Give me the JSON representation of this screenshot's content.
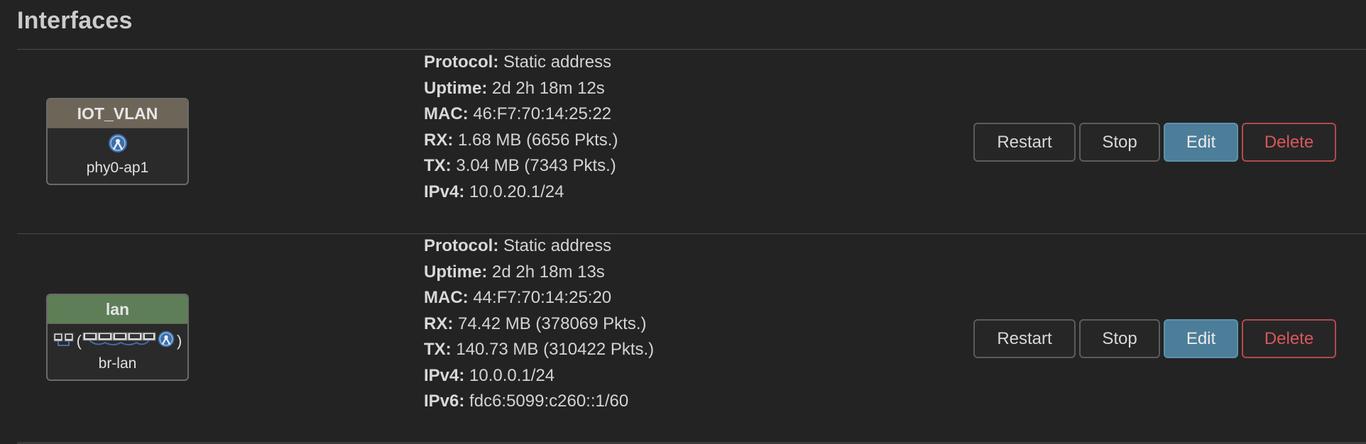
{
  "page": {
    "title": "Interfaces"
  },
  "labels": {
    "protocol": "Protocol:",
    "uptime": "Uptime:",
    "mac": "MAC:",
    "rx": "RX:",
    "tx": "TX:",
    "ipv4": "IPv4:",
    "ipv6": "IPv6:"
  },
  "buttons": {
    "restart": "Restart",
    "stop": "Stop",
    "edit": "Edit",
    "delete": "Delete"
  },
  "interfaces": [
    {
      "name": "IOT_VLAN",
      "device": "phy0-ap1",
      "header_color": "#6e6559",
      "icons": [
        "wifi-ap-icon"
      ],
      "protocol": "Static address",
      "uptime": "2d 2h 18m 12s",
      "mac": "46:F7:70:14:25:22",
      "rx": "1.68 MB (6656 Pkts.)",
      "tx": "3.04 MB (7343 Pkts.)",
      "ipv4": "10.0.20.1/24"
    },
    {
      "name": "lan",
      "device": "br-lan",
      "header_color": "#5e7e57",
      "icons": [
        "bridge-icon",
        "ethernet-ports-icon",
        "wifi-ap-icon"
      ],
      "bridge_open": "(",
      "bridge_close": ")",
      "protocol": "Static address",
      "uptime": "2d 2h 18m 13s",
      "mac": "44:F7:70:14:25:20",
      "rx": "74.42 MB (378069 Pkts.)",
      "tx": "140.73 MB (310422 Pkts.)",
      "ipv4": "10.0.0.1/24",
      "ipv6": "fdc6:5099:c260::1/60"
    }
  ]
}
